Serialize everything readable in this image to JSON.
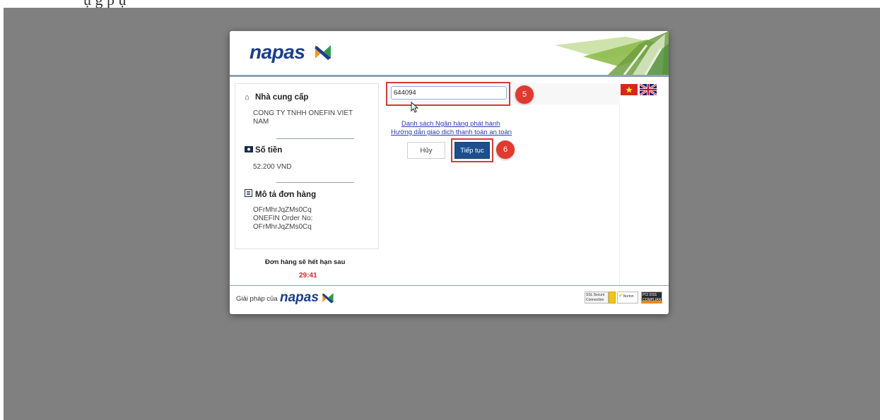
{
  "page": {
    "top_caption_fragment": "ụ                g    p   ụ"
  },
  "header": {
    "logo_text": "napas"
  },
  "merchant": {
    "title": "Nhà cung cấp",
    "name_line1": "CONG TY TNHH ONEFIN VIET",
    "name_line2": "NAM"
  },
  "amount": {
    "title": "Số tiền",
    "value": "52.200 VND"
  },
  "order": {
    "title": "Mô tả đơn hàng",
    "line1": "OFrMhrJqZMs0Cq",
    "line2": "ONEFIN Order No:",
    "line3": "OFrMhrJqZMs0Cq"
  },
  "expiry": {
    "label": "Đơn hàng sẽ hết hạn sau",
    "countdown": "29:41"
  },
  "form": {
    "card_value": "644094",
    "link_banks": "Danh sách Ngân hàng phát hành",
    "link_guide": "Hướng dẫn giao dịch thanh toán an toàn",
    "cancel_label": "Hủy",
    "continue_label": "Tiếp tục"
  },
  "annotations": {
    "step5": "5",
    "step6": "6"
  },
  "footer": {
    "prefix": "Giải pháp của",
    "logo_text": "napas",
    "badge_ssl": "SSL Secure Connection",
    "badge_norton": "Norton",
    "badge_pci": "PCI DSS COMPLIANT"
  },
  "colors": {
    "brand_blue": "#1b3e8a",
    "button_blue": "#1c4f8c",
    "annotation_red": "#e0392f",
    "countdown_red": "#d4272e",
    "backdrop_gray": "#808080"
  }
}
